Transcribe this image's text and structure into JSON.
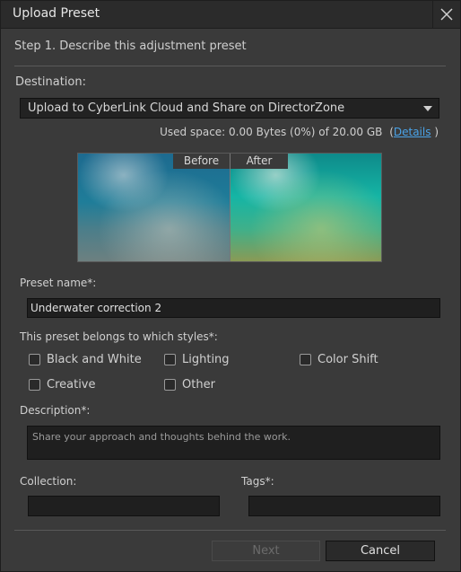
{
  "window": {
    "title": "Upload Preset"
  },
  "step": "Step 1. Describe this adjustment preset",
  "destination": {
    "label": "Destination:",
    "selected": "Upload to CyberLink Cloud and Share on DirectorZone"
  },
  "storage": {
    "text": "Used space: 0.00 Bytes (0%) of 20.00 GB",
    "paren_open": "(",
    "link": "Details",
    "paren_close": ")"
  },
  "preview": {
    "before": "Before",
    "after": "After"
  },
  "preset_name": {
    "label": "Preset name*:",
    "value": "Underwater correction 2"
  },
  "styles": {
    "label": "This preset belongs to which styles*:",
    "options": [
      "Black and White",
      "Lighting",
      "Color Shift",
      "Creative",
      "Other"
    ]
  },
  "description": {
    "label": "Description*:",
    "placeholder": "Share your approach and thoughts behind the work."
  },
  "collection": {
    "label": "Collection:",
    "value": ""
  },
  "tags": {
    "label": "Tags*:",
    "value": ""
  },
  "buttons": {
    "next": "Next",
    "cancel": "Cancel"
  }
}
